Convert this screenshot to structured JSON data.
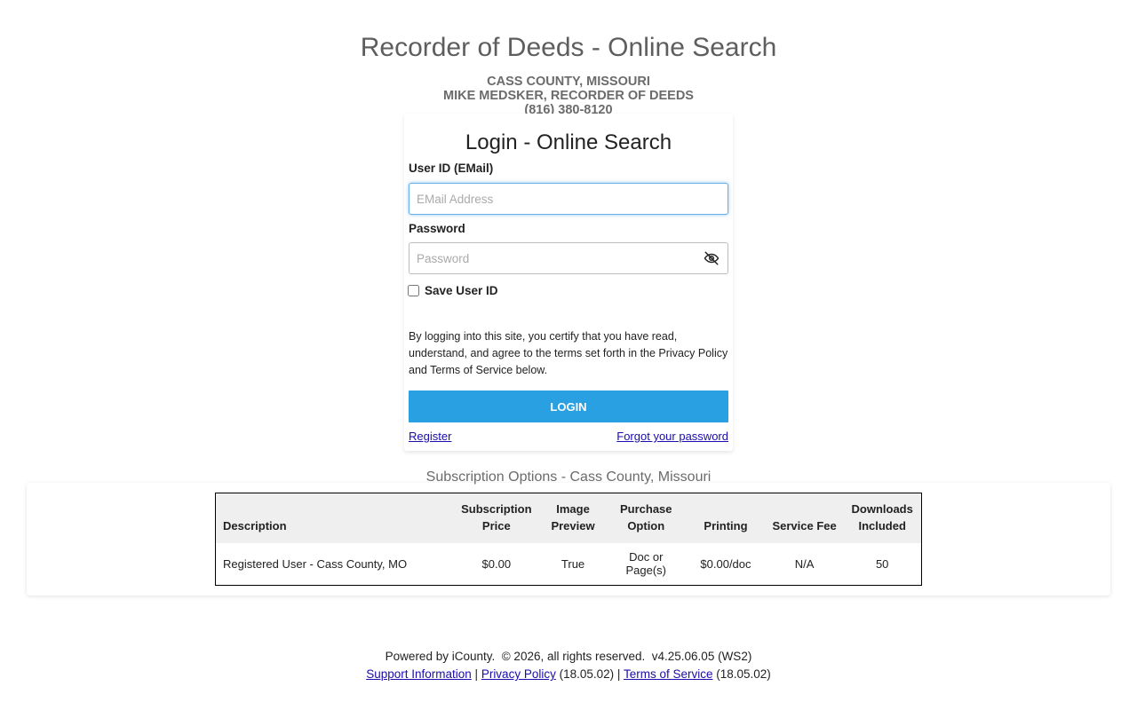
{
  "header": {
    "title": "Recorder of Deeds - Online Search",
    "county": "CASS COUNTY, MISSOURI",
    "recorder": "MIKE MEDSKER, RECORDER OF DEEDS",
    "phone": "(816) 380-8120"
  },
  "login": {
    "title": "Login - Online Search",
    "user_label": "User ID (EMail)",
    "user_placeholder": "EMail Address",
    "user_value": "",
    "password_label": "Password",
    "password_placeholder": "Password",
    "password_value": "",
    "save_label": "Save User ID",
    "save_checked": false,
    "terms": "By logging into this site, you certify that you have read, understand, and agree to the terms set forth in the Privacy Policy and Terms of Service below.",
    "button_label": "LOGIN",
    "register_label": "Register",
    "forgot_label": "Forgot your password",
    "icons": {
      "password_toggle": "eye-slash-icon"
    }
  },
  "subscriptions": {
    "title": "Subscription Options - Cass County, Missouri",
    "headers": [
      "Description",
      "Subscription Price",
      "Image Preview",
      "Purchase Option",
      "Printing",
      "Service Fee",
      "Downloads Included"
    ],
    "rows": [
      [
        "Registered User - Cass County, MO",
        "$0.00",
        "True",
        "Doc or Page(s)",
        "$0.00/doc",
        "N/A",
        "50"
      ]
    ]
  },
  "footer": {
    "powered": "Powered by iCounty.  © 2026, all rights reserved.  v4.25.06.05 (WS2)",
    "support_label": "Support Information",
    "separator": "|",
    "privacy_label": "Privacy Policy",
    "privacy_version": "(18.05.02)",
    "terms_label": "Terms of Service",
    "terms_version": "(18.05.02)"
  },
  "colors": {
    "login_button": "#29a0e2",
    "link": "#1a0dab",
    "title_gray": "#5e5e5e"
  }
}
